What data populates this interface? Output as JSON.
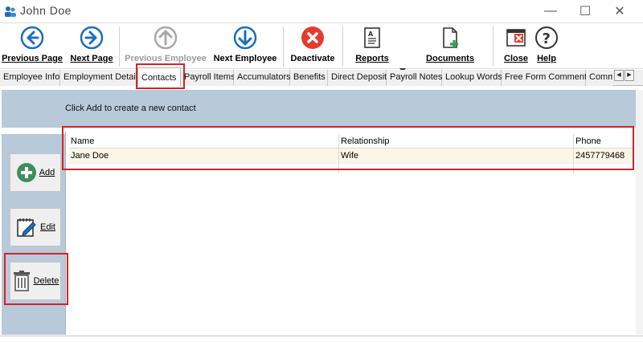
{
  "window": {
    "title": "John  Doe",
    "controls": {
      "minimize": "—",
      "maximize": "☐",
      "close": "✕"
    }
  },
  "toolbar": {
    "previous_page": "Previous Page",
    "next_page": "Next Page",
    "previous_employee": "Previous Employee",
    "next_employee": "Next Employee",
    "deactivate": "Deactivate",
    "reports": "Reports",
    "documents": "Documents",
    "close": "Close",
    "help": "Help"
  },
  "tabs": [
    "Employee Info",
    "Employment Details",
    "Contacts",
    "Payroll Items",
    "Accumulators",
    "Benefits",
    "Direct Deposit",
    "Payroll Notes",
    "Lookup Words",
    "Free Form Comments",
    "Comm"
  ],
  "active_tab": "Contacts",
  "contacts": {
    "hint": "Click Add to create a new contact",
    "columns": [
      "Name",
      "Relationship",
      "Phone"
    ],
    "rows": [
      {
        "name": "Jane Doe",
        "relationship": "Wife",
        "phone": "2457779468"
      }
    ]
  },
  "side_actions": {
    "add": "Add",
    "edit": "Edit",
    "delete": "Delete"
  },
  "colors": {
    "accent_blue": "#1f6fb5",
    "deactivate_red": "#e53b2c",
    "panel_bg": "#b8c9da",
    "row_highlight": "#fcf6e6",
    "annotation_red": "#d2232a"
  }
}
